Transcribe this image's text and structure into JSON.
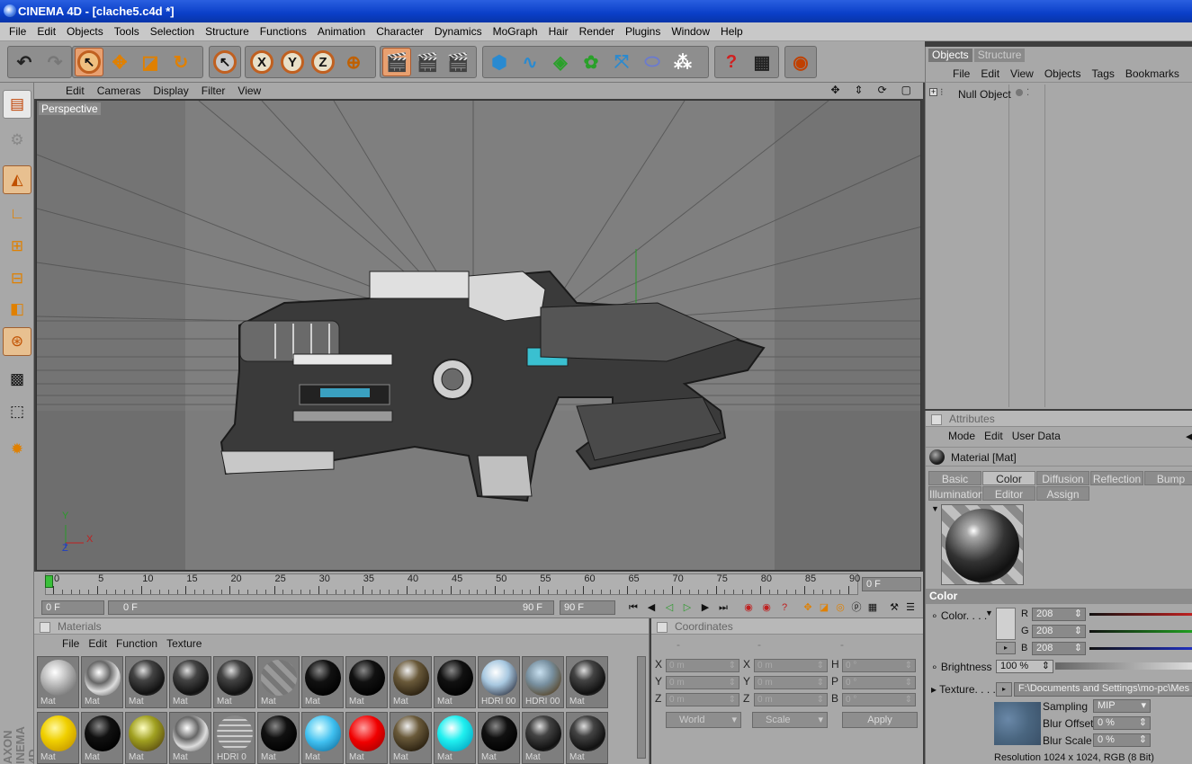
{
  "window": {
    "title": "CINEMA 4D - [clache5.c4d *]"
  },
  "menubar": [
    "File",
    "Edit",
    "Objects",
    "Tools",
    "Selection",
    "Structure",
    "Functions",
    "Animation",
    "Character",
    "Dynamics",
    "MoGraph",
    "Hair",
    "Render",
    "Plugins",
    "Window",
    "Help"
  ],
  "toolbar": {
    "axis_x": "X",
    "axis_y": "Y",
    "axis_z": "Z"
  },
  "viewport": {
    "menu": [
      "Edit",
      "Cameras",
      "Display",
      "Filter",
      "View"
    ],
    "label": "Perspective",
    "axis_labels": {
      "y": "Y",
      "z": "Z",
      "x": "X"
    }
  },
  "timeline": {
    "ticks": [
      "0",
      "5",
      "10",
      "15",
      "20",
      "25",
      "30",
      "35",
      "40",
      "45",
      "50",
      "55",
      "60",
      "65",
      "70",
      "75",
      "80",
      "85",
      "90"
    ],
    "current_frame": "0 F",
    "start_field": "0 F",
    "range_start": "0 F",
    "range_end": "90 F",
    "end_field": "90 F"
  },
  "materials": {
    "header": "Materials",
    "menu": [
      "File",
      "Edit",
      "Function",
      "Texture"
    ],
    "row1": [
      {
        "label": "Mat",
        "kind": "gray"
      },
      {
        "label": "Mat",
        "kind": "chrome"
      },
      {
        "label": "Mat",
        "kind": "dark"
      },
      {
        "label": "Mat",
        "kind": "dark"
      },
      {
        "label": "Mat",
        "kind": "dark"
      },
      {
        "label": "Mat",
        "kind": "stripe"
      },
      {
        "label": "Mat",
        "kind": "black"
      },
      {
        "label": "Mat",
        "kind": "black"
      },
      {
        "label": "Mat",
        "kind": "bronze"
      },
      {
        "label": "Mat",
        "kind": "black"
      },
      {
        "label": "HDRI 00",
        "kind": "hdri"
      },
      {
        "label": "HDRI 00",
        "kind": "hdri2"
      },
      {
        "label": "Mat",
        "kind": "dark"
      }
    ],
    "row2": [
      {
        "label": "Mat",
        "kind": "yellow"
      },
      {
        "label": "Mat",
        "kind": "black"
      },
      {
        "label": "Mat",
        "kind": "gold"
      },
      {
        "label": "Mat",
        "kind": "chrome"
      },
      {
        "label": "HDRI 0",
        "kind": "grid"
      },
      {
        "label": "Mat",
        "kind": "black"
      },
      {
        "label": "Mat",
        "kind": "cyan"
      },
      {
        "label": "Mat",
        "kind": "red"
      },
      {
        "label": "Mat",
        "kind": "bronze"
      },
      {
        "label": "Mat",
        "kind": "cyan2"
      },
      {
        "label": "Mat",
        "kind": "black"
      },
      {
        "label": "Mat",
        "kind": "dark"
      },
      {
        "label": "Mat",
        "kind": "dark"
      }
    ]
  },
  "coordinates": {
    "header": "Coordinates",
    "col_headers": [
      "-",
      "-",
      "-"
    ],
    "rows": [
      {
        "l1": "X",
        "v1": "0 m",
        "l2": "X",
        "v2": "0 m",
        "l3": "H",
        "v3": "0 °"
      },
      {
        "l1": "Y",
        "v1": "0 m",
        "l2": "Y",
        "v2": "0 m",
        "l3": "P",
        "v3": "0 °"
      },
      {
        "l1": "Z",
        "v1": "0 m",
        "l2": "Z",
        "v2": "0 m",
        "l3": "B",
        "v3": "0 °"
      }
    ],
    "world": "World",
    "scale": "Scale",
    "apply": "Apply"
  },
  "objects": {
    "tabs": [
      "Objects",
      "Structure"
    ],
    "menu": [
      "File",
      "Edit",
      "View",
      "Objects",
      "Tags",
      "Bookmarks"
    ],
    "items": [
      "Null Object"
    ]
  },
  "attributes": {
    "header": "Attributes",
    "menu": [
      "Mode",
      "Edit",
      "User Data"
    ],
    "material_name": "Material [Mat]",
    "tabs_row1": [
      "Basic",
      "Color",
      "Diffusion",
      "Reflection",
      "Bump"
    ],
    "tabs_row2": [
      "Illumination",
      "Editor",
      "Assign"
    ],
    "active_tab": "Color",
    "section": "Color",
    "color_label": "Color. . . .",
    "r_label": "R",
    "r": "208",
    "g_label": "G",
    "g": "208",
    "b_label": "B",
    "b": "208",
    "brightness_label": "Brightness",
    "brightness": "100 %",
    "texture_label": "Texture. . . .",
    "texture_path": "F:\\Documents and Settings\\mo-pc\\Mes d",
    "sampling_label": "Sampling",
    "sampling": "MIP",
    "blur_offset_label": "Blur Offset",
    "blur_offset": "0 %",
    "blur_scale_label": "Blur Scale",
    "blur_scale": "0 %",
    "resolution": "Resolution 1024 x 1024, RGB (8 Bit)"
  },
  "branding": {
    "line1": "AXON",
    "line2": "INEMA 4D"
  }
}
